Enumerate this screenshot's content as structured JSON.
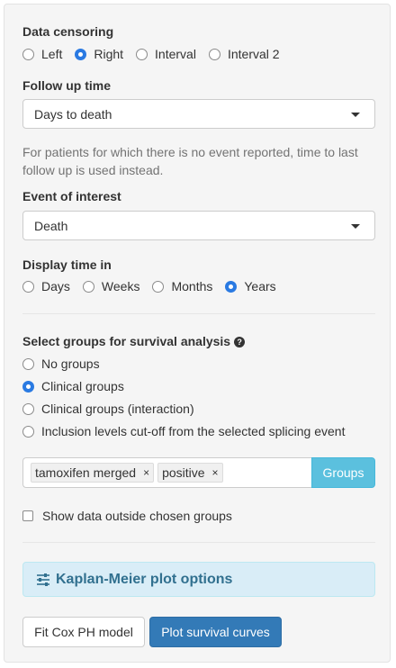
{
  "censoring": {
    "label": "Data censoring",
    "options": [
      "Left",
      "Right",
      "Interval",
      "Interval 2"
    ],
    "selected": "Right"
  },
  "followup": {
    "label": "Follow up time",
    "value": "Days to death",
    "help": "For patients for which there is no event reported, time to last follow up is used instead."
  },
  "event": {
    "label": "Event of interest",
    "value": "Death"
  },
  "display_time": {
    "label": "Display time in",
    "options": [
      "Days",
      "Weeks",
      "Months",
      "Years"
    ],
    "selected": "Years"
  },
  "groups": {
    "label": "Select groups for survival analysis",
    "options": [
      "No groups",
      "Clinical groups",
      "Clinical groups (interaction)",
      "Inclusion levels cut-off from the selected splicing event"
    ],
    "selected": "Clinical groups",
    "tags": [
      "tamoxifen merged",
      "positive"
    ],
    "tag_remove": "×",
    "button": "Groups"
  },
  "show_outside": {
    "label": "Show data outside chosen groups",
    "checked": false
  },
  "km_options": {
    "label": "Kaplan-Meier plot options"
  },
  "actions": {
    "fit_cox": "Fit Cox PH model",
    "plot": "Plot survival curves"
  },
  "colors": {
    "primary": "#337ab7",
    "info": "#5bc0de",
    "radio_selected": "#2a7ae2",
    "panel_bg": "#f5f5f5"
  }
}
